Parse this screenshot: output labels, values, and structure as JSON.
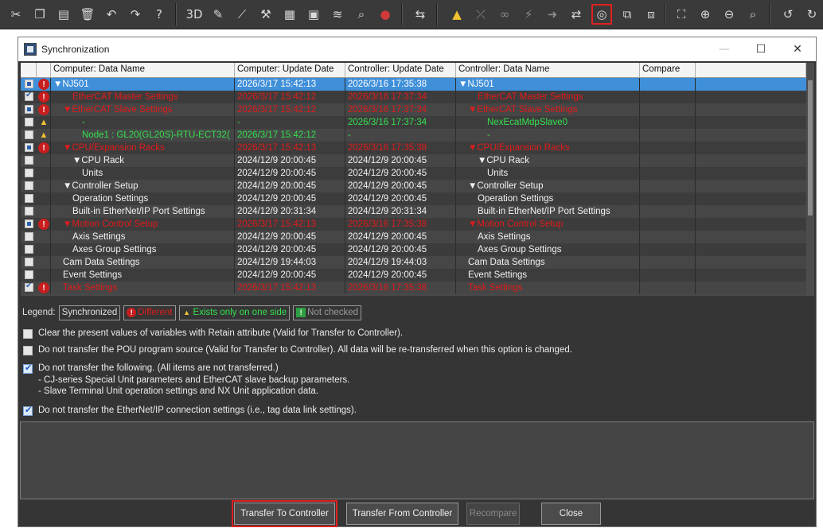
{
  "toolbar": {
    "items": [
      {
        "icon": "cut-icon",
        "glyph": "✂"
      },
      {
        "icon": "copy-icon",
        "glyph": "❐"
      },
      {
        "icon": "paste-icon",
        "glyph": "▤"
      },
      {
        "icon": "delete-icon",
        "glyph": "🗑"
      },
      {
        "icon": "undo-icon",
        "glyph": "↶"
      },
      {
        "icon": "redo-icon",
        "glyph": "↷"
      },
      {
        "icon": "help-icon",
        "glyph": "?"
      },
      {
        "icon": "3d-view-icon",
        "glyph": "3D"
      },
      {
        "icon": "edit-icon",
        "glyph": "✎"
      },
      {
        "icon": "line-icon",
        "glyph": "⟋"
      },
      {
        "icon": "build-icon",
        "glyph": "⚒"
      },
      {
        "icon": "rebuild-icon",
        "glyph": "▦"
      },
      {
        "icon": "check-icon",
        "glyph": "▣"
      },
      {
        "icon": "signal-icon",
        "glyph": "≋"
      },
      {
        "icon": "search-icon",
        "glyph": "⌕"
      },
      {
        "icon": "stop-icon",
        "glyph": "●"
      },
      {
        "icon": "online-icon",
        "glyph": "⇆"
      },
      {
        "icon": "warning-icon",
        "glyph": "▲"
      },
      {
        "icon": "offline-icon",
        "glyph": "⤫"
      },
      {
        "icon": "monitor-icon",
        "glyph": "∞"
      },
      {
        "icon": "force-icon",
        "glyph": "⚡"
      },
      {
        "icon": "transfer-icon",
        "glyph": "➜"
      },
      {
        "icon": "tools-icon",
        "glyph": "⇄"
      },
      {
        "icon": "synchronize-icon",
        "glyph": "◎"
      },
      {
        "icon": "compare-icon",
        "glyph": "⧉"
      },
      {
        "icon": "layout-icon",
        "glyph": "⧈"
      },
      {
        "icon": "frame-icon",
        "glyph": "⛶"
      },
      {
        "icon": "zoom-in-icon",
        "glyph": "⊕"
      },
      {
        "icon": "zoom-out-icon",
        "glyph": "⊖"
      },
      {
        "icon": "zoom-fit-icon",
        "glyph": "⌕"
      },
      {
        "icon": "history-back-icon",
        "glyph": "↺"
      },
      {
        "icon": "history-forward-icon",
        "glyph": "↻"
      }
    ]
  },
  "dialog": {
    "title": "Synchronization",
    "min_label": "—",
    "max_label": "☐",
    "close_label": "✕"
  },
  "grid": {
    "columns": [
      "",
      "",
      "Computer: Data Name",
      "Computer: Update Date",
      "Controller: Update Date",
      "Controller: Data Name",
      "Compare"
    ],
    "rows": [
      {
        "check": "part",
        "status": "diff",
        "c_name": "▼NJ501",
        "c_date": "2026/3/17 15:42:13",
        "k_date": "2026/3/16 17:35:38",
        "k_name": "▼NJ501",
        "color": "sel",
        "indent": 0,
        "k_indent": 0
      },
      {
        "check": "on",
        "status": "diff",
        "c_name": "EtherCAT Master Settings",
        "c_date": "2026/3/17 15:42:12",
        "k_date": "2026/3/16 17:37:34",
        "k_name": "EtherCAT Master Settings",
        "color": "red",
        "indent": 2,
        "k_indent": 2
      },
      {
        "check": "part",
        "status": "diff",
        "c_name": "▼EtherCAT Slave Settings",
        "c_date": "2026/3/17 15:42:12",
        "k_date": "2026/3/16 17:37:34",
        "k_name": "▼EtherCAT Slave Settings",
        "color": "red",
        "indent": 1,
        "k_indent": 1
      },
      {
        "check": "off",
        "status": "warn",
        "c_name": "-",
        "c_date": "-",
        "k_date": "2026/3/16 17:37:34",
        "k_name": "NexEcatMdpSlave0",
        "color": "green",
        "indent": 3,
        "k_indent": 3
      },
      {
        "check": "off",
        "status": "warn",
        "c_name": "Node1 : GL20(GL20S)-RTU-ECT32(",
        "c_date": "2026/3/17 15:42:12",
        "k_date": "-",
        "k_name": "-",
        "color": "green",
        "indent": 3,
        "k_indent": 3
      },
      {
        "check": "part",
        "status": "diff",
        "c_name": "▼CPU/Expansion Racks",
        "c_date": "2026/3/17 15:42:13",
        "k_date": "2026/3/16 17:35:38",
        "k_name": "▼CPU/Expansion Racks",
        "color": "red",
        "indent": 1,
        "k_indent": 1
      },
      {
        "check": "off",
        "status": "",
        "c_name": "▼CPU Rack",
        "c_date": "2024/12/9 20:00:45",
        "k_date": "2024/12/9 20:00:45",
        "k_name": "▼CPU Rack",
        "color": "white",
        "indent": 2,
        "k_indent": 2
      },
      {
        "check": "off",
        "status": "",
        "c_name": "Units",
        "c_date": "2024/12/9 20:00:45",
        "k_date": "2024/12/9 20:00:45",
        "k_name": "Units",
        "color": "white",
        "indent": 3,
        "k_indent": 3
      },
      {
        "check": "off",
        "status": "",
        "c_name": "▼Controller Setup",
        "c_date": "2024/12/9 20:00:45",
        "k_date": "2024/12/9 20:00:45",
        "k_name": "▼Controller Setup",
        "color": "white",
        "indent": 1,
        "k_indent": 1
      },
      {
        "check": "off",
        "status": "",
        "c_name": "Operation Settings",
        "c_date": "2024/12/9 20:00:45",
        "k_date": "2024/12/9 20:00:45",
        "k_name": "Operation Settings",
        "color": "white",
        "indent": 2,
        "k_indent": 2
      },
      {
        "check": "off",
        "status": "",
        "c_name": "Built-in EtherNet/IP Port Settings",
        "c_date": "2024/12/9 20:31:34",
        "k_date": "2024/12/9 20:31:34",
        "k_name": "Built-in EtherNet/IP Port Settings",
        "color": "white",
        "indent": 2,
        "k_indent": 2
      },
      {
        "check": "part",
        "status": "diff",
        "c_name": "▼Motion Control Setup",
        "c_date": "2026/3/17 15:42:13",
        "k_date": "2026/3/16 17:35:38",
        "k_name": "▼Motion Control Setup",
        "color": "red",
        "indent": 1,
        "k_indent": 1
      },
      {
        "check": "off",
        "status": "",
        "c_name": "Axis Settings",
        "c_date": "2024/12/9 20:00:45",
        "k_date": "2024/12/9 20:00:45",
        "k_name": "Axis Settings",
        "color": "white",
        "indent": 2,
        "k_indent": 2
      },
      {
        "check": "off",
        "status": "",
        "c_name": "Axes Group Settings",
        "c_date": "2024/12/9 20:00:45",
        "k_date": "2024/12/9 20:00:45",
        "k_name": "Axes Group Settings",
        "color": "white",
        "indent": 2,
        "k_indent": 2
      },
      {
        "check": "off",
        "status": "",
        "c_name": "Cam Data Settings",
        "c_date": "2024/12/9 19:44:03",
        "k_date": "2024/12/9 19:44:03",
        "k_name": "Cam Data Settings",
        "color": "white",
        "indent": 1,
        "k_indent": 1
      },
      {
        "check": "off",
        "status": "",
        "c_name": "Event Settings",
        "c_date": "2024/12/9 20:00:45",
        "k_date": "2024/12/9 20:00:45",
        "k_name": "Event Settings",
        "color": "white",
        "indent": 1,
        "k_indent": 1
      },
      {
        "check": "on",
        "status": "diff",
        "c_name": "Task Settings",
        "c_date": "2026/3/17 15:42:13",
        "k_date": "2026/3/16 17:35:38",
        "k_name": "Task Settings",
        "color": "red",
        "indent": 1,
        "k_indent": 1
      }
    ]
  },
  "legend": {
    "label": "Legend:",
    "synchronized": "Synchronized",
    "different": "Different",
    "exists_one_side": "Exists only on one side",
    "not_checked": "Not checked"
  },
  "options": [
    {
      "checked": false,
      "text": "Clear the present values of variables with Retain attribute (Valid for Transfer to Controller)."
    },
    {
      "checked": false,
      "text": "Do not transfer the POU program source (Valid for Transfer to Controller). All data will be re-transferred when this option is changed."
    },
    {
      "checked": true,
      "text": "Do not transfer the following. (All items are not transferred.)",
      "sub": [
        "- CJ-series Special Unit parameters and EtherCAT slave backup parameters.",
        "- Slave Terminal Unit operation settings and NX Unit application data."
      ]
    },
    {
      "checked": true,
      "text": "Do not transfer the EtherNet/IP connection settings (i.e., tag data link settings)."
    }
  ],
  "buttons": {
    "transfer_to": "Transfer To Controller",
    "transfer_from": "Transfer From Controller",
    "recompare": "Recompare",
    "close": "Close"
  },
  "colors": {
    "red": "#e01c1c",
    "green": "#35e04e",
    "selection": "#3f8fd9",
    "highlight": "#e02020"
  }
}
